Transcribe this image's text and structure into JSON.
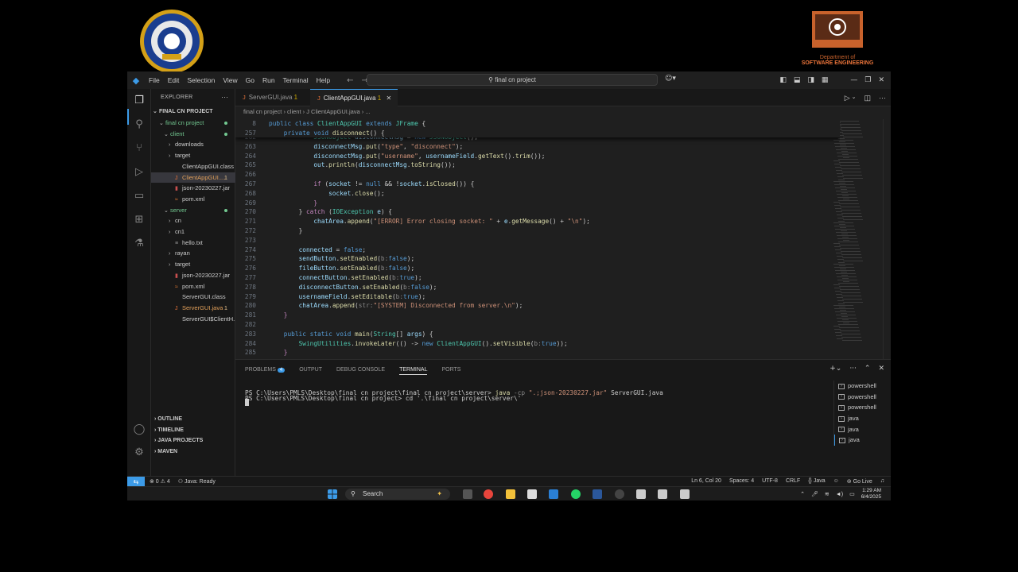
{
  "logo_right": {
    "line1": "Department of",
    "line2": "SOFTWARE ENGINEERING"
  },
  "titlebar": {
    "menu": [
      "File",
      "Edit",
      "Selection",
      "View",
      "Go",
      "Run",
      "Terminal",
      "Help"
    ],
    "search": "final cn project"
  },
  "sidebar": {
    "header": "EXPLORER",
    "root": "FINAL CN PROJECT",
    "tree": [
      {
        "label": "final cn project",
        "depth": 1,
        "type": "folder-open",
        "dot": true
      },
      {
        "label": "client",
        "depth": 2,
        "type": "folder-open",
        "dot": true
      },
      {
        "label": "downloads",
        "depth": 3,
        "type": "folder"
      },
      {
        "label": "target",
        "depth": 3,
        "type": "folder"
      },
      {
        "label": "ClientAppGUI.class",
        "depth": 3,
        "type": "file"
      },
      {
        "label": "ClientAppGUI....",
        "depth": 3,
        "type": "java",
        "badge": "1",
        "selected": true
      },
      {
        "label": "json-20230227.jar",
        "depth": 3,
        "type": "jar"
      },
      {
        "label": "pom.xml",
        "depth": 3,
        "type": "xml"
      },
      {
        "label": "server",
        "depth": 2,
        "type": "folder-open",
        "dot": true
      },
      {
        "label": "cn",
        "depth": 3,
        "type": "folder"
      },
      {
        "label": "cn1",
        "depth": 3,
        "type": "folder"
      },
      {
        "label": "hello.txt",
        "depth": 3,
        "type": "txt"
      },
      {
        "label": "rayan",
        "depth": 3,
        "type": "folder"
      },
      {
        "label": "target",
        "depth": 3,
        "type": "folder"
      },
      {
        "label": "json-20230227.jar",
        "depth": 3,
        "type": "jar"
      },
      {
        "label": "pom.xml",
        "depth": 3,
        "type": "xml"
      },
      {
        "label": "ServerGUI.class",
        "depth": 3,
        "type": "file"
      },
      {
        "label": "ServerGUI.java",
        "depth": 3,
        "type": "java",
        "badge": "1"
      },
      {
        "label": "ServerGUI$ClientH...",
        "depth": 3,
        "type": "file"
      }
    ],
    "bottom_sections": [
      "OUTLINE",
      "TIMELINE",
      "JAVA PROJECTS",
      "MAVEN"
    ]
  },
  "tabs": [
    {
      "label": "ServerGUI.java",
      "badge": "1",
      "active": false
    },
    {
      "label": "ClientAppGUI.java",
      "badge": "1",
      "active": true,
      "close": "✕"
    }
  ],
  "breadcrumb": "final cn project  ›  client  ›  J ClientAppGUI.java  ›  ...",
  "code": {
    "sticky": [
      {
        "n": "8",
        "html": "<span class='k'>public class</span> <span class='t'>ClientAppGUI</span> <span class='k'>extends</span> <span class='t'>JFrame</span> <span class='p'>{</span>"
      },
      {
        "n": "257",
        "html": "    <span class='k'>private void</span> <span class='f'>disconnect</span><span class='p'>() {</span>"
      }
    ],
    "lines": [
      {
        "n": "262",
        "html": "            <span class='t'>JSONObject</span> <span class='v'>disconnectMsg</span> <span class='p'>=</span> <span class='k'>new</span> <span class='t'>JSONObject</span><span class='p'>();</span>"
      },
      {
        "n": "263",
        "html": "            <span class='v'>disconnectMsg</span><span class='p'>.</span><span class='f'>put</span><span class='p'>(</span><span class='s'>\"type\"</span><span class='p'>, </span><span class='s'>\"disconnect\"</span><span class='p'>);</span>"
      },
      {
        "n": "264",
        "html": "            <span class='v'>disconnectMsg</span><span class='p'>.</span><span class='f'>put</span><span class='p'>(</span><span class='s'>\"username\"</span><span class='p'>, </span><span class='v'>usernameField</span><span class='p'>.</span><span class='f'>getText</span><span class='p'>().</span><span class='f'>trim</span><span class='p'>());</span>"
      },
      {
        "n": "265",
        "html": "            <span class='v'>out</span><span class='p'>.</span><span class='f'>println</span><span class='p'>(</span><span class='v'>disconnectMsg</span><span class='p'>.</span><span class='f'>toString</span><span class='p'>());</span>"
      },
      {
        "n": "266",
        "html": ""
      },
      {
        "n": "267",
        "html": "            <span class='kw'>if</span> <span class='p'>(</span><span class='v'>socket</span> <span class='p'>!=</span> <span class='k'>null</span> <span class='p'>&amp;&amp; !</span><span class='v'>socket</span><span class='p'>.</span><span class='f'>isClosed</span><span class='p'>()) {</span>"
      },
      {
        "n": "268",
        "html": "                <span class='v'>socket</span><span class='p'>.</span><span class='f'>close</span><span class='p'>();</span>"
      },
      {
        "n": "269",
        "html": "            <span class='kw'>}</span>"
      },
      {
        "n": "270",
        "html": "        <span class='p'>}</span> <span class='kw'>catch</span> <span class='p'>(</span><span class='t'>IOException</span> <span class='v'>e</span><span class='p'>) {</span>"
      },
      {
        "n": "271",
        "html": "            <span class='v'>chatArea</span><span class='p'>.</span><span class='f'>append</span><span class='p'>(</span><span class='s'>\"[ERROR] Error closing socket: \"</span> <span class='p'>+</span> <span class='v'>e</span><span class='p'>.</span><span class='f'>getMessage</span><span class='p'>() +</span> <span class='s'>\"\\n\"</span><span class='p'>);</span>"
      },
      {
        "n": "272",
        "html": "        <span class='p'>}</span>"
      },
      {
        "n": "273",
        "html": ""
      },
      {
        "n": "274",
        "html": "        <span class='v'>connected</span> <span class='p'>=</span> <span class='k'>false</span><span class='p'>;</span>"
      },
      {
        "n": "275",
        "html": "        <span class='v'>sendButton</span><span class='p'>.</span><span class='f'>setEnabled</span><span class='p'>(</span><span class='h'>b:</span><span class='k'>false</span><span class='p'>);</span>"
      },
      {
        "n": "276",
        "html": "        <span class='v'>fileButton</span><span class='p'>.</span><span class='f'>setEnabled</span><span class='p'>(</span><span class='h'>b:</span><span class='k'>false</span><span class='p'>);</span>"
      },
      {
        "n": "277",
        "html": "        <span class='v'>connectButton</span><span class='p'>.</span><span class='f'>setEnabled</span><span class='p'>(</span><span class='h'>b:</span><span class='k'>true</span><span class='p'>);</span>"
      },
      {
        "n": "278",
        "html": "        <span class='v'>disconnectButton</span><span class='p'>.</span><span class='f'>setEnabled</span><span class='p'>(</span><span class='h'>b:</span><span class='k'>false</span><span class='p'>);</span>"
      },
      {
        "n": "279",
        "html": "        <span class='v'>usernameField</span><span class='p'>.</span><span class='f'>setEditable</span><span class='p'>(</span><span class='h'>b:</span><span class='k'>true</span><span class='p'>);</span>"
      },
      {
        "n": "280",
        "html": "        <span class='v'>chatArea</span><span class='p'>.</span><span class='f'>append</span><span class='p'>(</span><span class='h'>str:</span><span class='s'>\"[SYSTEM] Disconnected from server.\\n\"</span><span class='p'>);</span>"
      },
      {
        "n": "281",
        "html": "    <span class='kw'>}</span>"
      },
      {
        "n": "282",
        "html": ""
      },
      {
        "n": "283",
        "html": "    <span class='k'>public static void</span> <span class='f'>main</span><span class='p'>(</span><span class='t'>String</span><span class='p'>[]</span> <span class='v'>args</span><span class='p'>) {</span>"
      },
      {
        "n": "284",
        "html": "        <span class='t'>SwingUtilities</span><span class='p'>.</span><span class='f'>invokeLater</span><span class='p'>(() -&gt;</span> <span class='k'>new</span> <span class='t'>ClientAppGUI</span><span class='p'>().</span><span class='f'>setVisible</span><span class='p'>(</span><span class='h'>b:</span><span class='k'>true</span><span class='p'>));</span>"
      },
      {
        "n": "285",
        "html": "    <span class='kw'>}</span>"
      }
    ]
  },
  "panel": {
    "tabs": [
      {
        "label": "PROBLEMS",
        "badge": "4"
      },
      {
        "label": "OUTPUT"
      },
      {
        "label": "DEBUG CONSOLE"
      },
      {
        "label": "TERMINAL",
        "active": true
      },
      {
        "label": "PORTS"
      }
    ],
    "terminal": [
      "PS C:\\Users\\PMLS\\Desktop\\final cn project> cd '.\\final cn project\\server\\'",
      "PS C:\\Users\\PMLS\\Desktop\\final cn project\\final cn project\\server> java -cp \".;json-20230227.jar\" ServerGUI.java"
    ],
    "terminal_list": [
      "powershell",
      "powershell",
      "powershell",
      "java",
      "java",
      "java"
    ]
  },
  "statusbar": {
    "problems": "⊗ 0 ⚠ 4",
    "java": "Java: Ready",
    "position": "Ln 6, Col 20",
    "spaces": "Spaces: 4",
    "encoding": "UTF-8",
    "eol": "CRLF",
    "language": "{} Java",
    "golive": "Go Live"
  },
  "taskbar": {
    "search": "Search",
    "time": "1:29 AM",
    "date": "6/4/2025"
  }
}
